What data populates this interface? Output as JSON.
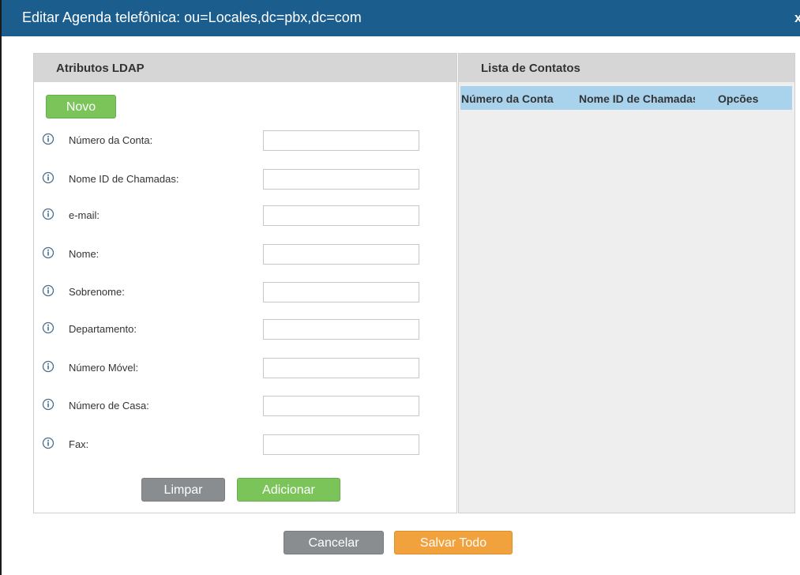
{
  "dialog": {
    "title": "Editar Agenda telefônica: ou=Locales,dc=pbx,dc=com",
    "close_label": "x"
  },
  "left_panel": {
    "header": "Atributos LDAP",
    "new_button": "Novo",
    "fields": [
      {
        "label": "Número da Conta:",
        "value": ""
      },
      {
        "label": "Nome ID de Chamadas:",
        "value": ""
      },
      {
        "label": "e-mail:",
        "value": ""
      },
      {
        "label": "Nome:",
        "value": ""
      },
      {
        "label": "Sobrenome:",
        "value": ""
      },
      {
        "label": "Departamento:",
        "value": ""
      },
      {
        "label": "Número Móvel:",
        "value": ""
      },
      {
        "label": "Número de Casa:",
        "value": ""
      },
      {
        "label": "Fax:",
        "value": ""
      }
    ],
    "clear_button": "Limpar",
    "add_button": "Adicionar"
  },
  "right_panel": {
    "header": "Lista de Contatos",
    "columns": [
      "Número da Conta",
      "Nome ID de Chamadas",
      "Opcões"
    ]
  },
  "footer": {
    "cancel_button": "Cancelar",
    "save_all_button": "Salvar Todo"
  },
  "colors": {
    "titlebar": "#1b5d8c",
    "green": "#7ac45a",
    "gray": "#8a8d8f",
    "orange": "#f2a23c",
    "grid_header": "#a9d3ed"
  }
}
